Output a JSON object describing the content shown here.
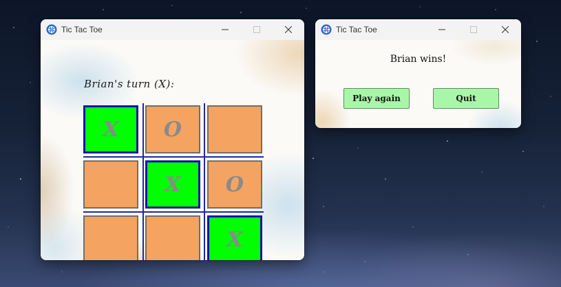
{
  "main_window": {
    "title": "Tic Tac Toe",
    "turn_label": "Brian's turn (X):",
    "board": [
      {
        "mark": "X",
        "winning": true
      },
      {
        "mark": "O",
        "winning": false
      },
      {
        "mark": "",
        "winning": false
      },
      {
        "mark": "",
        "winning": false
      },
      {
        "mark": "X",
        "winning": true
      },
      {
        "mark": "O",
        "winning": false
      },
      {
        "mark": "",
        "winning": false
      },
      {
        "mark": "",
        "winning": false
      },
      {
        "mark": "X",
        "winning": true
      }
    ]
  },
  "dialog_window": {
    "title": "Tic Tac Toe",
    "message": "Brian wins!",
    "play_again_label": "Play again",
    "quit_label": "Quit"
  },
  "colors": {
    "cell_default": "#f4a460",
    "cell_winning": "#00ff00",
    "button": "#a8f7a8",
    "grid_line": "#1f2a9e"
  },
  "icons": {
    "app": "tic-tac-toe-app-icon",
    "minimize": "minimize-icon",
    "maximize": "maximize-icon",
    "close": "close-icon"
  }
}
